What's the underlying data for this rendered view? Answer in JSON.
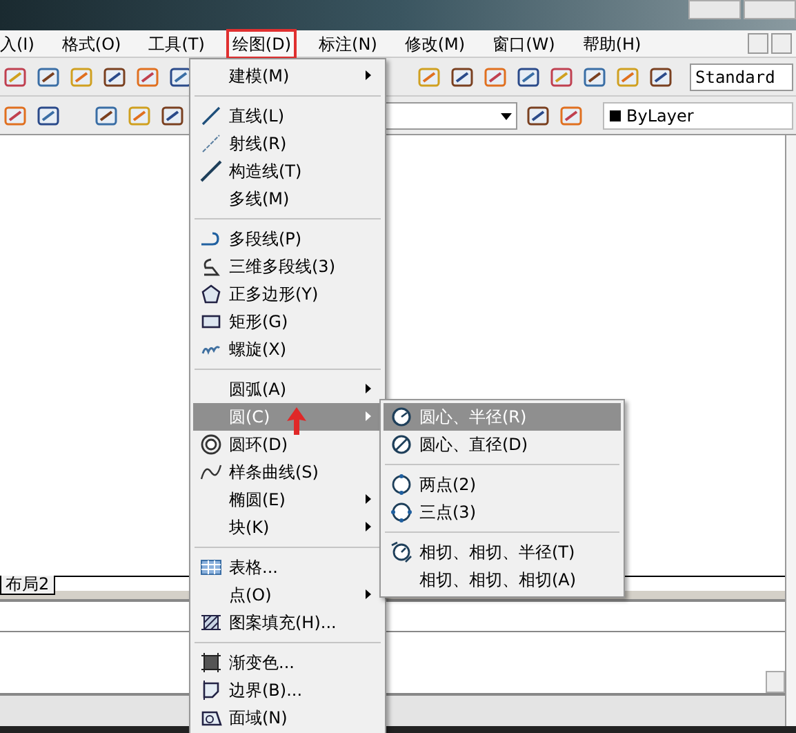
{
  "menubar": [
    {
      "label": "入(I)",
      "selected": false
    },
    {
      "label": "格式(O)",
      "selected": false
    },
    {
      "label": "工具(T)",
      "selected": false
    },
    {
      "label": "绘图(D)",
      "selected": true
    },
    {
      "label": "标注(N)",
      "selected": false
    },
    {
      "label": "修改(M)",
      "selected": false
    },
    {
      "label": "窗口(W)",
      "selected": false
    },
    {
      "label": "帮助(H)",
      "selected": false
    }
  ],
  "toolbar": {
    "text_style": "Standard",
    "color_field": "ByLayer"
  },
  "layout_tab": "布局2",
  "menu": [
    {
      "kind": "item",
      "label": "建模(M)",
      "submenu": true,
      "highlighted": false
    },
    {
      "kind": "separator"
    },
    {
      "kind": "item",
      "label": "直线(L)",
      "submenu": false,
      "highlighted": false
    },
    {
      "kind": "item",
      "label": "射线(R)",
      "submenu": false,
      "highlighted": false
    },
    {
      "kind": "item",
      "label": "构造线(T)",
      "submenu": false,
      "highlighted": false
    },
    {
      "kind": "item",
      "label": "多线(M)",
      "submenu": false,
      "highlighted": false
    },
    {
      "kind": "separator"
    },
    {
      "kind": "item",
      "label": "多段线(P)",
      "submenu": false,
      "highlighted": false
    },
    {
      "kind": "item",
      "label": "三维多段线(3)",
      "submenu": false,
      "highlighted": false
    },
    {
      "kind": "item",
      "label": "正多边形(Y)",
      "submenu": false,
      "highlighted": false
    },
    {
      "kind": "item",
      "label": "矩形(G)",
      "submenu": false,
      "highlighted": false
    },
    {
      "kind": "item",
      "label": "螺旋(X)",
      "submenu": false,
      "highlighted": false
    },
    {
      "kind": "separator"
    },
    {
      "kind": "item",
      "label": "圆弧(A)",
      "submenu": true,
      "highlighted": false
    },
    {
      "kind": "item",
      "label": "圆(C)",
      "submenu": true,
      "highlighted": true
    },
    {
      "kind": "item",
      "label": "圆环(D)",
      "submenu": false,
      "highlighted": false
    },
    {
      "kind": "item",
      "label": "样条曲线(S)",
      "submenu": false,
      "highlighted": false
    },
    {
      "kind": "item",
      "label": "椭圆(E)",
      "submenu": true,
      "highlighted": false
    },
    {
      "kind": "item",
      "label": "块(K)",
      "submenu": true,
      "highlighted": false
    },
    {
      "kind": "separator"
    },
    {
      "kind": "item",
      "label": "表格...",
      "submenu": false,
      "highlighted": false
    },
    {
      "kind": "item",
      "label": "点(O)",
      "submenu": true,
      "highlighted": false
    },
    {
      "kind": "item",
      "label": "图案填充(H)...",
      "submenu": false,
      "highlighted": false
    },
    {
      "kind": "separator"
    },
    {
      "kind": "item",
      "label": "渐变色...",
      "submenu": false,
      "highlighted": false
    },
    {
      "kind": "item",
      "label": "边界(B)...",
      "submenu": false,
      "highlighted": false
    },
    {
      "kind": "item",
      "label": "面域(N)",
      "submenu": false,
      "highlighted": false
    }
  ],
  "submenu": [
    {
      "kind": "item",
      "label": "圆心、半径(R)",
      "highlighted": true
    },
    {
      "kind": "item",
      "label": "圆心、直径(D)",
      "highlighted": false
    },
    {
      "kind": "separator"
    },
    {
      "kind": "item",
      "label": "两点(2)",
      "highlighted": false
    },
    {
      "kind": "item",
      "label": "三点(3)",
      "highlighted": false
    },
    {
      "kind": "separator"
    },
    {
      "kind": "item",
      "label": "相切、相切、半径(T)",
      "highlighted": false
    },
    {
      "kind": "item",
      "label": "相切、相切、相切(A)",
      "highlighted": false
    }
  ]
}
